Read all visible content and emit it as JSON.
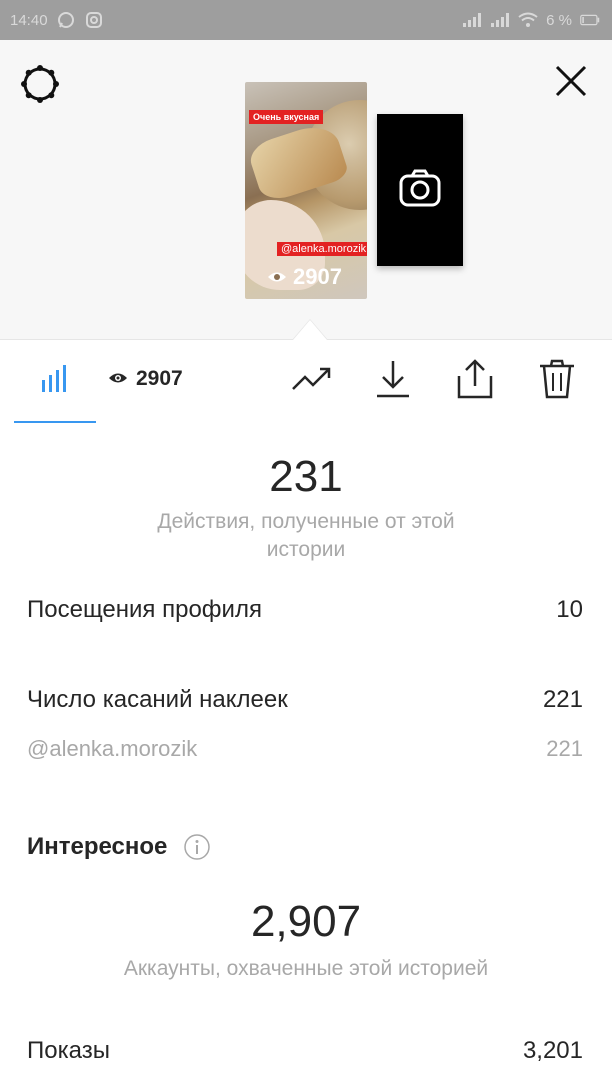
{
  "status_bar": {
    "time": "14:40",
    "battery": "6 %",
    "icons": [
      "whatsapp-icon",
      "instagram-icon",
      "signal-icon",
      "signal-icon",
      "wifi-icon",
      "battery-icon"
    ]
  },
  "header": {
    "settings_icon": "gear-icon",
    "close_icon": "close-icon"
  },
  "story_preview": {
    "caption": "Очень вкусная",
    "mention": "@alenka.morozik",
    "views": "2907",
    "add_icon": "camera-icon"
  },
  "toolbar": {
    "stats_icon": "bar-chart-icon",
    "views_count": "2907",
    "tools": [
      "trending-icon",
      "download-icon",
      "share-icon",
      "trash-icon"
    ]
  },
  "interactions": {
    "value": "231",
    "caption": "Действия, полученные от этой истории",
    "rows": [
      {
        "label": "Посещения профиля",
        "value": "10"
      },
      {
        "label": "Число касаний наклеек",
        "value": "221"
      }
    ],
    "sub_rows": [
      {
        "label": "@alenka.morozik",
        "value": "221"
      }
    ]
  },
  "discovery": {
    "title": "Интересное",
    "reach_value": "2,907",
    "reach_caption": "Аккаунты, охваченные этой историей",
    "rows": [
      {
        "label": "Показы",
        "value": "3,201"
      }
    ]
  },
  "colors": {
    "accent": "#3897f0",
    "status_bar": "#9e9e9e",
    "text_primary": "#262626",
    "text_secondary": "#a8a8a8",
    "sticker_red": "#e32222"
  }
}
